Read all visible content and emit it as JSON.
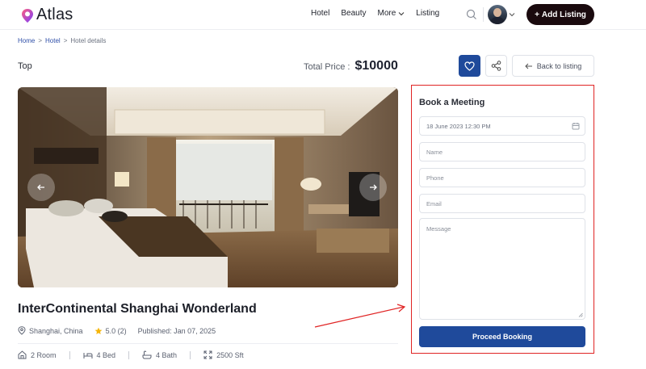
{
  "header": {
    "logo_text": "Atlas",
    "nav": [
      {
        "label": "Hotel"
      },
      {
        "label": "Beauty"
      },
      {
        "label": "More"
      },
      {
        "label": "Listing"
      }
    ],
    "add_listing_label": "Add Listing",
    "add_listing_plus": "+"
  },
  "breadcrumb": {
    "items": [
      "Home",
      "Hotel",
      "Hotel details"
    ],
    "separator": ">"
  },
  "title_row": {
    "top_label": "Top",
    "total_price_label": "Total Price :",
    "total_price_value": "$10000",
    "back_label": "Back to listing"
  },
  "hotel": {
    "name": "InterContinental Shanghai Wonderland",
    "location": "Shanghai, China",
    "rating": "5.0 (2)",
    "published": "Published: Jan 07, 2025",
    "amenities": [
      {
        "icon": "room-icon",
        "label": "2 Room"
      },
      {
        "icon": "bed-icon",
        "label": "4 Bed"
      },
      {
        "icon": "bath-icon",
        "label": "4 Bath"
      },
      {
        "icon": "area-icon",
        "label": "2500 Sft"
      }
    ]
  },
  "booking": {
    "title": "Book a Meeting",
    "date_value": "18 June 2023 12:30 PM",
    "name_placeholder": "Name",
    "phone_placeholder": "Phone",
    "email_placeholder": "Email",
    "message_placeholder": "Message",
    "proceed_label": "Proceed Booking"
  },
  "colors": {
    "primary": "#1f4a9b",
    "dark_button": "#1a0a0e",
    "highlight_border": "#e02424",
    "star": "#f5b50a",
    "logo_accent": "#d6338f"
  }
}
